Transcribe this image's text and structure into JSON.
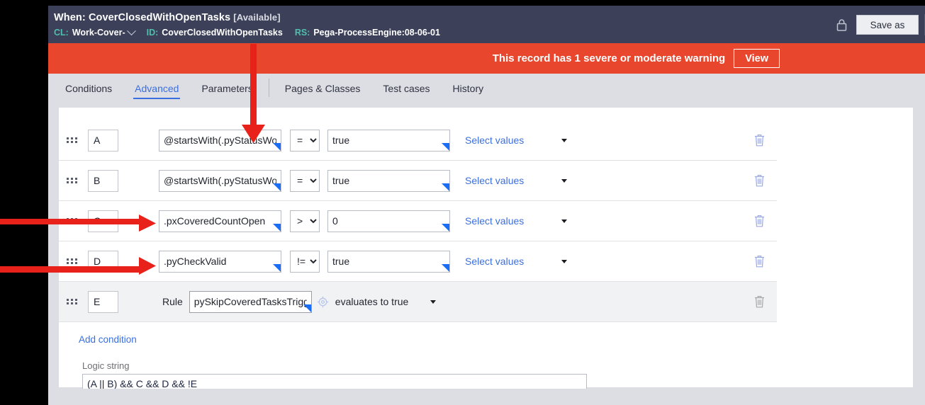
{
  "header": {
    "title_prefix": "When:",
    "title_name": "CoverClosedWithOpenTasks",
    "title_status": "[Available]",
    "cl_label": "CL:",
    "cl_value": "Work-Cover-",
    "id_label": "ID:",
    "id_value": "CoverClosedWithOpenTasks",
    "rs_label": "RS:",
    "rs_value": "Pega-ProcessEngine:08-06-01",
    "lock_icon": "lock-icon",
    "save_as_label": "Save as",
    "bg_color": "#3c4159",
    "label_color": "#4fbfae"
  },
  "warning": {
    "message": "This record has 1 severe or moderate warning",
    "view_label": "View",
    "bg_color": "#e8472e"
  },
  "tabs": [
    {
      "label": "Conditions",
      "active": false
    },
    {
      "label": "Advanced",
      "active": true
    },
    {
      "label": "Parameters",
      "active": false
    },
    {
      "label": "Pages & Classes",
      "active": false
    },
    {
      "label": "Test cases",
      "active": false
    },
    {
      "label": "History",
      "active": false
    }
  ],
  "tab_separator_after": 2,
  "accent_color": "#3a6fe0",
  "conditions": {
    "select_values_label": "Select values",
    "delete_icon": "trash-icon",
    "rows": [
      {
        "label": "A",
        "left": "@startsWith(.pyStatusWo",
        "operator": "=",
        "right": "true",
        "type": "expression"
      },
      {
        "label": "B",
        "left": "@startsWith(.pyStatusWo",
        "operator": "=",
        "right": "true",
        "type": "expression"
      },
      {
        "label": "C",
        "left": ".pxCoveredCountOpen",
        "operator": ">",
        "right": "0",
        "type": "expression"
      },
      {
        "label": "D",
        "left": ".pyCheckValid",
        "operator": "!=",
        "right": "true",
        "type": "expression"
      }
    ],
    "rule_row": {
      "label": "E",
      "rule_label": "Rule",
      "rule_value": "pySkipCoveredTasksTrigg",
      "target_icon": "crosshair-icon",
      "evaluates_label": "evaluates to true",
      "type": "rule"
    },
    "operator_options": [
      "=",
      "!=",
      ">",
      "<",
      ">=",
      "<="
    ]
  },
  "add_condition_label": "Add condition",
  "logic": {
    "label": "Logic string",
    "value": "(A || B) && C && D && !E"
  }
}
